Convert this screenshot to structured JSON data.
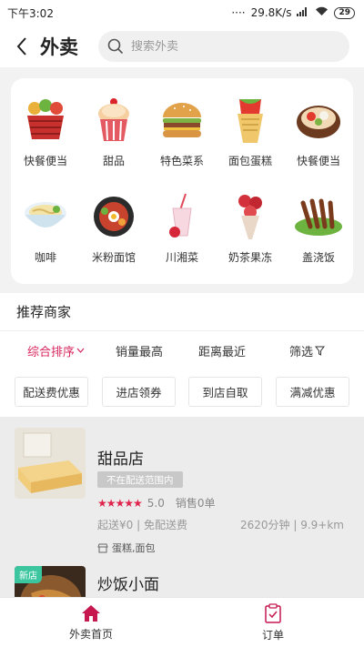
{
  "status_bar": {
    "time": "下午3:02",
    "signal": "····",
    "net_speed": "29.8K/s",
    "battery": "29"
  },
  "header": {
    "title": "外卖",
    "search_placeholder": "搜索外卖"
  },
  "categories": [
    {
      "label": "快餐便当",
      "icon": "fast-food-basket-icon"
    },
    {
      "label": "甜品",
      "icon": "cupcake-icon"
    },
    {
      "label": "特色菜系",
      "icon": "burger-icon"
    },
    {
      "label": "面包蛋糕",
      "icon": "wrap-sandwich-icon"
    },
    {
      "label": "快餐便当",
      "icon": "hotpot-bowl-icon"
    },
    {
      "label": "咖啡",
      "icon": "noodle-bowl-icon"
    },
    {
      "label": "米粉面馆",
      "icon": "bibimbap-icon"
    },
    {
      "label": "川湘菜",
      "icon": "milkshake-icon"
    },
    {
      "label": "奶茶果冻",
      "icon": "flower-bouquet-icon"
    },
    {
      "label": "盖浇饭",
      "icon": "skewers-icon"
    }
  ],
  "recommend": {
    "title": "推荐商家"
  },
  "sort_options": [
    {
      "label": "综合排序",
      "active": true
    },
    {
      "label": "销量最高"
    },
    {
      "label": "距离最近"
    },
    {
      "label": "筛选"
    }
  ],
  "filters": [
    "配送费优惠",
    "进店领券",
    "到店自取",
    "满减优惠"
  ],
  "shops": [
    {
      "name": "甜品店",
      "tag": "不在配送范围内",
      "stars": "★★★★★",
      "rating": "5.0",
      "sales": "销售0单",
      "min_delivery": "起送¥0 | 免配送费",
      "distance": "2620分钟 | 9.9+km",
      "cats": "蛋糕,面包"
    },
    {
      "name": "炒饭小面",
      "badge": "新店"
    }
  ],
  "tabs": [
    {
      "label": "外卖首页",
      "active": true
    },
    {
      "label": "订单"
    }
  ],
  "colors": {
    "accent": "#d6245c",
    "star": "#e0254d",
    "new_badge": "#3cc6a0"
  }
}
